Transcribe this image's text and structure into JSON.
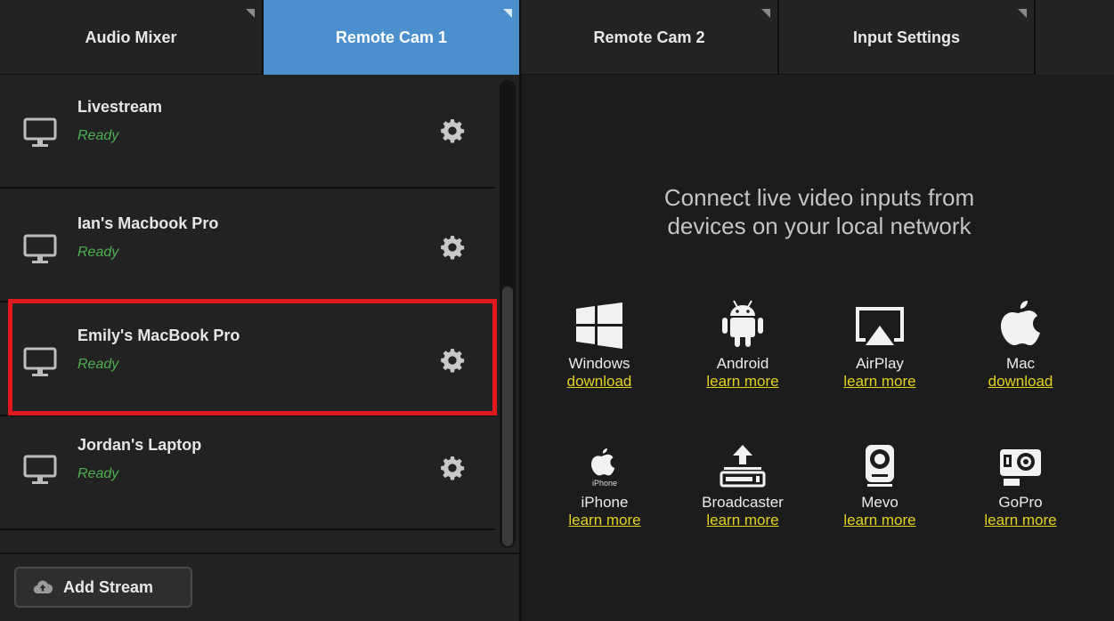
{
  "tabs": [
    {
      "label": "Audio Mixer",
      "active": false
    },
    {
      "label": "Remote Cam 1",
      "active": true
    },
    {
      "label": "Remote Cam 2",
      "active": false
    },
    {
      "label": "Input Settings",
      "active": false
    }
  ],
  "streams": [
    {
      "name": "Livestream",
      "status": "Ready"
    },
    {
      "name": "Ian's Macbook Pro",
      "status": "Ready"
    },
    {
      "name": "Emily's MacBook Pro",
      "status": "Ready",
      "highlighted": true
    },
    {
      "name": "Jordan's Laptop",
      "status": "Ready"
    }
  ],
  "add_stream_label": "Add Stream",
  "right": {
    "heading_line1": "Connect live video inputs from",
    "heading_line2": "devices on your local network",
    "devices": [
      {
        "name": "Windows",
        "link": "download",
        "icon": "windows-icon"
      },
      {
        "name": "Android",
        "link": "learn more",
        "icon": "android-icon"
      },
      {
        "name": "AirPlay",
        "link": "learn more",
        "icon": "airplay-icon"
      },
      {
        "name": "Mac",
        "link": "download",
        "icon": "apple-icon"
      },
      {
        "name": "iPhone",
        "link": "learn more",
        "icon": "iphone-icon",
        "icon_caption": "iPhone"
      },
      {
        "name": "Broadcaster",
        "link": "learn more",
        "icon": "broadcaster-icon"
      },
      {
        "name": "Mevo",
        "link": "learn more",
        "icon": "mevo-icon"
      },
      {
        "name": "GoPro",
        "link": "learn more",
        "icon": "gopro-icon"
      }
    ]
  },
  "colors": {
    "active_tab": "#4b8fcc",
    "status_ready": "#4caf50",
    "link": "#e2d11f",
    "highlight_border": "#e0191f"
  }
}
